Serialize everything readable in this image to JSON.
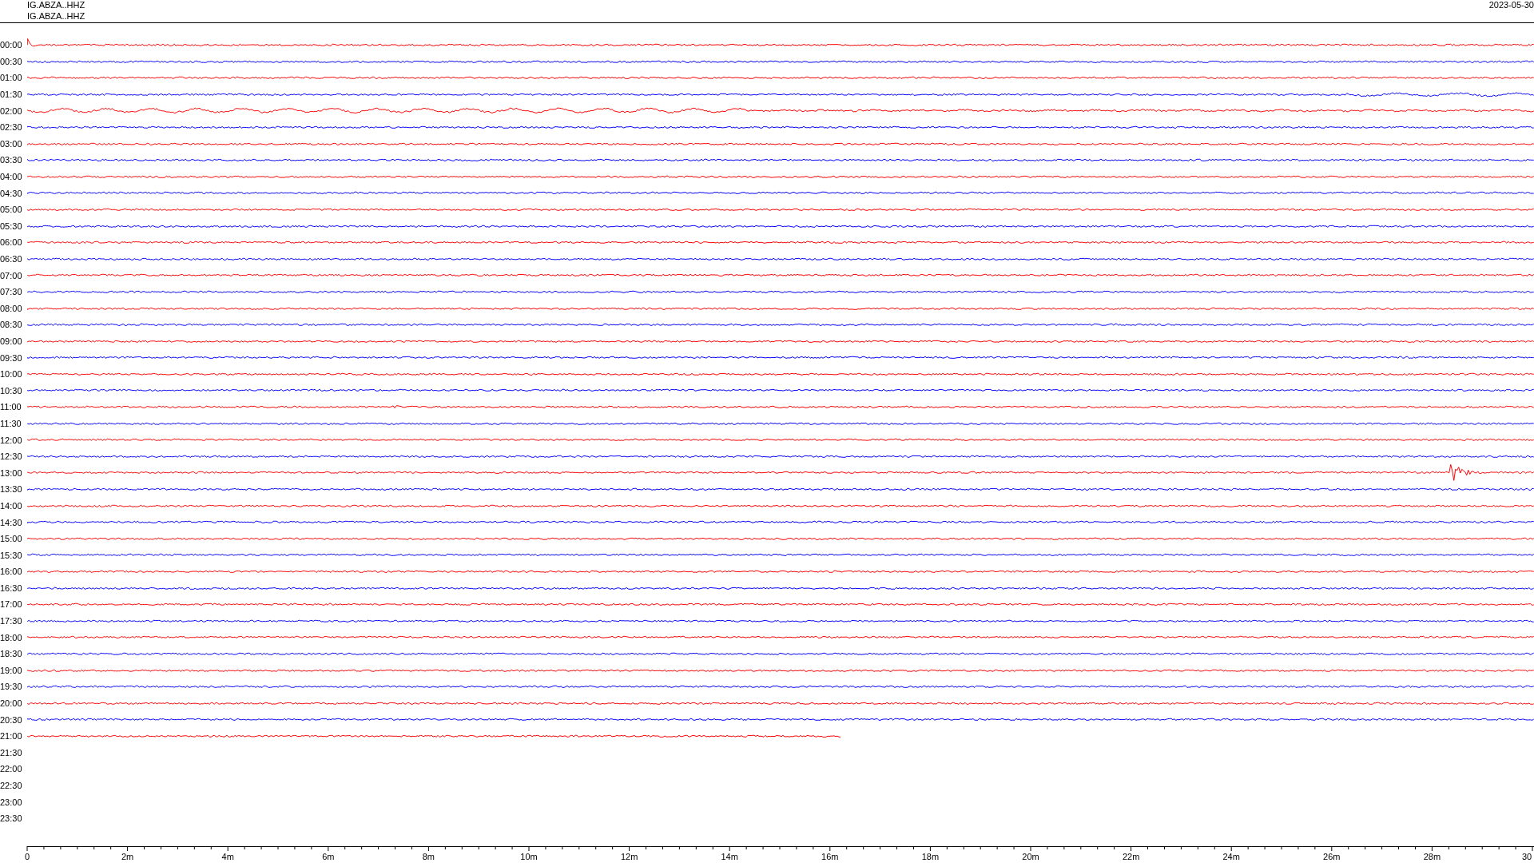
{
  "header": {
    "station_labels": [
      "IG.ABZA..HHZ",
      "IG.ABZA..HHZ"
    ],
    "date": "2023-05-30"
  },
  "rows": [
    {
      "time": "00:00",
      "color": "#ff0000",
      "level": 1
    },
    {
      "time": "00:30",
      "color": "#0000ff",
      "level": 1
    },
    {
      "time": "01:00",
      "color": "#ff0000",
      "level": 1
    },
    {
      "time": "01:30",
      "color": "#0000ff",
      "level": 1
    },
    {
      "time": "02:00",
      "color": "#ff0000",
      "level": 1
    },
    {
      "time": "02:30",
      "color": "#0000ff",
      "level": 1
    },
    {
      "time": "03:00",
      "color": "#ff0000",
      "level": 1
    },
    {
      "time": "03:30",
      "color": "#0000ff",
      "level": 1
    },
    {
      "time": "04:00",
      "color": "#ff0000",
      "level": 1
    },
    {
      "time": "04:30",
      "color": "#0000ff",
      "level": 1
    },
    {
      "time": "05:00",
      "color": "#ff0000",
      "level": 1
    },
    {
      "time": "05:30",
      "color": "#0000ff",
      "level": 1
    },
    {
      "time": "06:00",
      "color": "#ff0000",
      "level": 1
    },
    {
      "time": "06:30",
      "color": "#0000ff",
      "level": 1
    },
    {
      "time": "07:00",
      "color": "#ff0000",
      "level": 1
    },
    {
      "time": "07:30",
      "color": "#0000ff",
      "level": 1
    },
    {
      "time": "08:00",
      "color": "#ff0000",
      "level": 1
    },
    {
      "time": "08:30",
      "color": "#0000ff",
      "level": 1
    },
    {
      "time": "09:00",
      "color": "#ff0000",
      "level": 1
    },
    {
      "time": "09:30",
      "color": "#0000ff",
      "level": 1
    },
    {
      "time": "10:00",
      "color": "#ff0000",
      "level": 1
    },
    {
      "time": "10:30",
      "color": "#0000ff",
      "level": 1
    },
    {
      "time": "11:00",
      "color": "#ff0000",
      "level": 1
    },
    {
      "time": "11:30",
      "color": "#0000ff",
      "level": 1
    },
    {
      "time": "12:00",
      "color": "#ff0000",
      "level": 1
    },
    {
      "time": "12:30",
      "color": "#0000ff",
      "level": 1
    },
    {
      "time": "13:00",
      "color": "#ff0000",
      "level": 1
    },
    {
      "time": "13:30",
      "color": "#0000ff",
      "level": 1
    },
    {
      "time": "14:00",
      "color": "#ff0000",
      "level": 1
    },
    {
      "time": "14:30",
      "color": "#0000ff",
      "level": 1
    },
    {
      "time": "15:00",
      "color": "#ff0000",
      "level": 1
    },
    {
      "time": "15:30",
      "color": "#0000ff",
      "level": 1
    },
    {
      "time": "16:00",
      "color": "#ff0000",
      "level": 1
    },
    {
      "time": "16:30",
      "color": "#0000ff",
      "level": 1
    },
    {
      "time": "17:00",
      "color": "#ff0000",
      "level": 1
    },
    {
      "time": "17:30",
      "color": "#0000ff",
      "level": 1
    },
    {
      "time": "18:00",
      "color": "#ff0000",
      "level": 1
    },
    {
      "time": "18:30",
      "color": "#0000ff",
      "level": 1
    },
    {
      "time": "19:00",
      "color": "#ff0000",
      "level": 1
    },
    {
      "time": "19:30",
      "color": "#0000ff",
      "level": 1
    },
    {
      "time": "20:00",
      "color": "#ff0000",
      "level": 1
    },
    {
      "time": "20:30",
      "color": "#0000ff",
      "level": 1
    },
    {
      "time": "21:00",
      "color": "#ff0000",
      "level": 0.54
    },
    {
      "time": "21:30"
    },
    {
      "time": "22:00"
    },
    {
      "time": "22:30"
    },
    {
      "time": "23:00"
    },
    {
      "time": "23:30"
    }
  ],
  "x_axis": {
    "labels": [
      "0",
      "2m",
      "4m",
      "6m",
      "8m",
      "10m",
      "12m",
      "14m",
      "16m",
      "18m",
      "20m",
      "22m",
      "24m",
      "26m",
      "28m",
      "30"
    ]
  }
}
